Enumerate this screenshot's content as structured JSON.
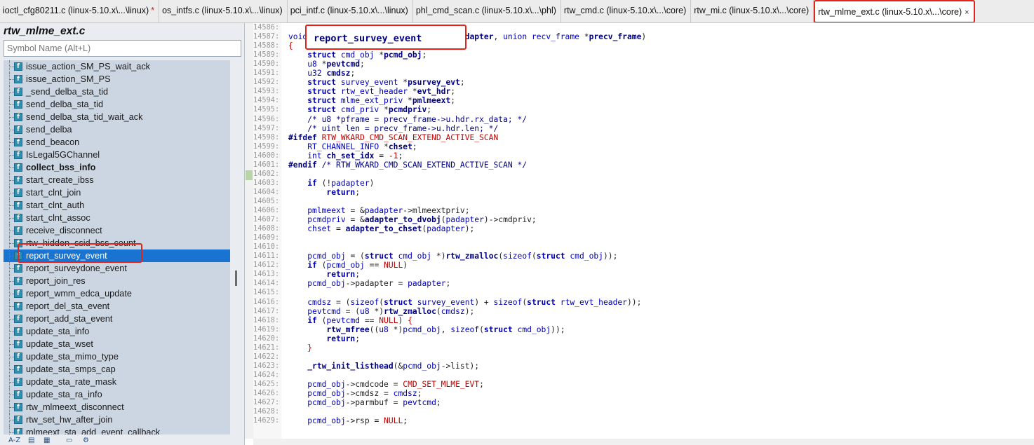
{
  "tabs": [
    {
      "label": "ioctl_cfg80211.c (linux-5.10.x\\...\\linux)",
      "dirty": "*",
      "active": false
    },
    {
      "label": "os_intfs.c (linux-5.10.x\\...\\linux)",
      "active": false
    },
    {
      "label": "pci_intf.c (linux-5.10.x\\...\\linux)",
      "active": false
    },
    {
      "label": "phl_cmd_scan.c (linux-5.10.x\\...\\phl)",
      "active": false
    },
    {
      "label": "rtw_cmd.c (linux-5.10.x\\...\\core)",
      "active": false
    },
    {
      "label": "rtw_mi.c (linux-5.10.x\\...\\core)",
      "active": false
    },
    {
      "label": "rtw_mlme_ext.c (linux-5.10.x\\...\\core)",
      "active": true,
      "close": "×"
    }
  ],
  "symbol_panel": {
    "file_title": "rtw_mlme_ext.c",
    "search_placeholder": "Symbol Name (Alt+L)",
    "items": [
      {
        "label": "issue_action_SM_PS_wait_ack"
      },
      {
        "label": "issue_action_SM_PS"
      },
      {
        "label": "_send_delba_sta_tid"
      },
      {
        "label": "send_delba_sta_tid"
      },
      {
        "label": "send_delba_sta_tid_wait_ack"
      },
      {
        "label": "send_delba"
      },
      {
        "label": "send_beacon"
      },
      {
        "label": "IsLegal5GChannel"
      },
      {
        "label": "collect_bss_info",
        "bold": true
      },
      {
        "label": "start_create_ibss"
      },
      {
        "label": "start_clnt_join"
      },
      {
        "label": "start_clnt_auth"
      },
      {
        "label": "start_clnt_assoc"
      },
      {
        "label": "receive_disconnect"
      },
      {
        "label": "rtw_hidden_ssid_bss_count"
      },
      {
        "label": "report_survey_event",
        "selected": true
      },
      {
        "label": "report_surveydone_event"
      },
      {
        "label": "report_join_res"
      },
      {
        "label": "report_wmm_edca_update"
      },
      {
        "label": "report_del_sta_event"
      },
      {
        "label": "report_add_sta_event"
      },
      {
        "label": "update_sta_info"
      },
      {
        "label": "update_sta_wset"
      },
      {
        "label": "update_sta_mimo_type"
      },
      {
        "label": "update_sta_smps_cap"
      },
      {
        "label": "update_sta_rate_mask"
      },
      {
        "label": "update_sta_ra_info"
      },
      {
        "label": "rtw_mlmeext_disconnect"
      },
      {
        "label": "rtw_set_hw_after_join"
      },
      {
        "label": "mlmeext_sta_add_event_callback"
      }
    ],
    "tool_labels": [
      "A-Z"
    ],
    "function_icon": "function-icon",
    "colors": {
      "selected": "#1874d0",
      "highlight_box": "#e3241b"
    }
  },
  "editor": {
    "function_name": "report_survey_event",
    "line_numbers": [
      "14586:",
      "14587:",
      "14588:",
      "14589:",
      "14590:",
      "14591:",
      "14592:",
      "14593:",
      "14594:",
      "14595:",
      "14596:",
      "14597:",
      "14598:",
      "14599:",
      "14600:",
      "14601:",
      "14602:",
      "14603:",
      "14604:",
      "14605:",
      "14606:",
      "14607:",
      "14608:",
      "14609:",
      "14610:",
      "14611:",
      "14612:",
      "14613:",
      "14614:",
      "14615:",
      "14616:",
      "14617:",
      "14618:",
      "14619:",
      "14620:",
      "14621:",
      "14622:",
      "14623:",
      "14624:",
      "14625:",
      "14626:",
      "14627:",
      "14628:",
      "14629:"
    ],
    "lines": [
      {
        "segs": []
      },
      {
        "segs": [
          [
            "kw",
            "void "
          ],
          [
            "fn",
            "report_survey_event"
          ],
          [
            "plain",
            "("
          ],
          [
            "kw",
            "_adapter "
          ],
          [
            "plain",
            "*"
          ],
          [
            "var",
            "padapter"
          ],
          [
            "plain",
            ", "
          ],
          [
            "kw",
            "union recv_frame "
          ],
          [
            "plain",
            "*"
          ],
          [
            "var",
            "precv_frame"
          ],
          [
            "plain",
            ")"
          ]
        ]
      },
      {
        "segs": [
          [
            "brace",
            "{"
          ]
        ]
      },
      {
        "segs": [
          [
            "plain",
            "    "
          ],
          [
            "kwb",
            "struct "
          ],
          [
            "kw",
            "cmd_obj "
          ],
          [
            "plain",
            "*"
          ],
          [
            "var",
            "pcmd_obj"
          ],
          [
            "plain",
            ";"
          ]
        ]
      },
      {
        "segs": [
          [
            "plain",
            "    "
          ],
          [
            "kw",
            "u8 "
          ],
          [
            "plain",
            "*"
          ],
          [
            "var",
            "pevtcmd"
          ],
          [
            "plain",
            ";"
          ]
        ]
      },
      {
        "segs": [
          [
            "plain",
            "    "
          ],
          [
            "kw",
            "u32 "
          ],
          [
            "var",
            "cmdsz"
          ],
          [
            "plain",
            ";"
          ]
        ]
      },
      {
        "segs": [
          [
            "plain",
            "    "
          ],
          [
            "kwb",
            "struct "
          ],
          [
            "kw",
            "survey_event "
          ],
          [
            "plain",
            "*"
          ],
          [
            "var",
            "psurvey_evt"
          ],
          [
            "plain",
            ";"
          ]
        ]
      },
      {
        "segs": [
          [
            "plain",
            "    "
          ],
          [
            "kwb",
            "struct "
          ],
          [
            "kw",
            "rtw_evt_header "
          ],
          [
            "plain",
            "*"
          ],
          [
            "var",
            "evt_hdr"
          ],
          [
            "plain",
            ";"
          ]
        ]
      },
      {
        "segs": [
          [
            "plain",
            "    "
          ],
          [
            "kwb",
            "struct "
          ],
          [
            "kw",
            "mlme_ext_priv "
          ],
          [
            "plain",
            "*"
          ],
          [
            "var",
            "pmlmeext"
          ],
          [
            "plain",
            ";"
          ]
        ]
      },
      {
        "segs": [
          [
            "plain",
            "    "
          ],
          [
            "kwb",
            "struct "
          ],
          [
            "kw",
            "cmd_priv "
          ],
          [
            "plain",
            "*"
          ],
          [
            "var",
            "pcmdpriv"
          ],
          [
            "plain",
            ";"
          ]
        ]
      },
      {
        "segs": [
          [
            "plain",
            "    "
          ],
          [
            "cm",
            "/* u8 *pframe = precv_frame->u.hdr.rx_data; */"
          ]
        ]
      },
      {
        "segs": [
          [
            "plain",
            "    "
          ],
          [
            "cm",
            "/* uint len = precv_frame->u.hdr.len; */"
          ]
        ]
      },
      {
        "segs": [
          [
            "pp",
            "#ifdef "
          ],
          [
            "mac",
            "RTW_WKARD_CMD_SCAN_EXTEND_ACTIVE_SCAN"
          ]
        ]
      },
      {
        "segs": [
          [
            "plain",
            "    "
          ],
          [
            "kw",
            "RT_CHANNEL_INFO "
          ],
          [
            "plain",
            "*"
          ],
          [
            "var",
            "chset"
          ],
          [
            "plain",
            ";"
          ]
        ]
      },
      {
        "segs": [
          [
            "plain",
            "    "
          ],
          [
            "kw",
            "int "
          ],
          [
            "var",
            "ch_set_idx"
          ],
          [
            "plain",
            " = "
          ],
          [
            "num",
            "-1"
          ],
          [
            "plain",
            ";"
          ]
        ]
      },
      {
        "segs": [
          [
            "pp",
            "#endif "
          ],
          [
            "cm",
            "/* RTW_WKARD_CMD_SCAN_EXTEND_ACTIVE_SCAN */"
          ]
        ]
      },
      {
        "segs": []
      },
      {
        "segs": [
          [
            "plain",
            "    "
          ],
          [
            "kwb",
            "if "
          ],
          [
            "plain",
            "(!"
          ],
          [
            "kw",
            "padapter"
          ],
          [
            "plain",
            ")"
          ]
        ]
      },
      {
        "segs": [
          [
            "plain",
            "        "
          ],
          [
            "kwb",
            "return"
          ],
          [
            "plain",
            ";"
          ]
        ]
      },
      {
        "segs": []
      },
      {
        "segs": [
          [
            "plain",
            "    "
          ],
          [
            "kw",
            "pmlmeext"
          ],
          [
            "plain",
            " = &"
          ],
          [
            "kw",
            "padapter"
          ],
          [
            "plain",
            "->mlmeextpriv;"
          ]
        ]
      },
      {
        "segs": [
          [
            "plain",
            "    "
          ],
          [
            "kw",
            "pcmdpriv"
          ],
          [
            "plain",
            " = &"
          ],
          [
            "fn",
            "adapter_to_dvobj"
          ],
          [
            "plain",
            "("
          ],
          [
            "kw",
            "padapter"
          ],
          [
            "plain",
            ")->cmdpriv;"
          ]
        ]
      },
      {
        "segs": [
          [
            "plain",
            "    "
          ],
          [
            "kw",
            "chset"
          ],
          [
            "plain",
            " = "
          ],
          [
            "fn",
            "adapter_to_chset"
          ],
          [
            "plain",
            "("
          ],
          [
            "kw",
            "padapter"
          ],
          [
            "plain",
            ");"
          ]
        ]
      },
      {
        "segs": []
      },
      {
        "segs": []
      },
      {
        "segs": [
          [
            "plain",
            "    "
          ],
          [
            "kw",
            "pcmd_obj"
          ],
          [
            "plain",
            " = ("
          ],
          [
            "kwb",
            "struct "
          ],
          [
            "kw",
            "cmd_obj "
          ],
          [
            "plain",
            "*)"
          ],
          [
            "fn",
            "rtw_zmalloc"
          ],
          [
            "plain",
            "("
          ],
          [
            "kw",
            "sizeof"
          ],
          [
            "plain",
            "("
          ],
          [
            "kwb",
            "struct "
          ],
          [
            "kw",
            "cmd_obj"
          ],
          [
            "plain",
            "));"
          ]
        ]
      },
      {
        "segs": [
          [
            "plain",
            "    "
          ],
          [
            "kwb",
            "if "
          ],
          [
            "plain",
            "("
          ],
          [
            "kw",
            "pcmd_obj"
          ],
          [
            "plain",
            " == "
          ],
          [
            "mac",
            "NULL"
          ],
          [
            "plain",
            ")"
          ]
        ]
      },
      {
        "segs": [
          [
            "plain",
            "        "
          ],
          [
            "kwb",
            "return"
          ],
          [
            "plain",
            ";"
          ]
        ]
      },
      {
        "segs": [
          [
            "plain",
            "    "
          ],
          [
            "kw",
            "pcmd_obj"
          ],
          [
            "plain",
            "->padapter = "
          ],
          [
            "kw",
            "padapter"
          ],
          [
            "plain",
            ";"
          ]
        ]
      },
      {
        "segs": []
      },
      {
        "segs": [
          [
            "plain",
            "    "
          ],
          [
            "kw",
            "cmdsz"
          ],
          [
            "plain",
            " = ("
          ],
          [
            "kw",
            "sizeof"
          ],
          [
            "plain",
            "("
          ],
          [
            "kwb",
            "struct "
          ],
          [
            "kw",
            "survey_event"
          ],
          [
            "plain",
            ") + "
          ],
          [
            "kw",
            "sizeof"
          ],
          [
            "plain",
            "("
          ],
          [
            "kwb",
            "struct "
          ],
          [
            "kw",
            "rtw_evt_header"
          ],
          [
            "plain",
            "));"
          ]
        ]
      },
      {
        "segs": [
          [
            "plain",
            "    "
          ],
          [
            "kw",
            "pevtcmd"
          ],
          [
            "plain",
            " = ("
          ],
          [
            "kw",
            "u8 "
          ],
          [
            "plain",
            "*)"
          ],
          [
            "fn",
            "rtw_zmalloc"
          ],
          [
            "plain",
            "("
          ],
          [
            "kw",
            "cmdsz"
          ],
          [
            "plain",
            ");"
          ]
        ]
      },
      {
        "segs": [
          [
            "plain",
            "    "
          ],
          [
            "kwb",
            "if "
          ],
          [
            "plain",
            "("
          ],
          [
            "kw",
            "pevtcmd"
          ],
          [
            "plain",
            " == "
          ],
          [
            "mac",
            "NULL"
          ],
          [
            "plain",
            ") "
          ],
          [
            "brace",
            "{"
          ]
        ]
      },
      {
        "segs": [
          [
            "plain",
            "        "
          ],
          [
            "fn",
            "rtw_mfree"
          ],
          [
            "plain",
            "(("
          ],
          [
            "kw",
            "u8 "
          ],
          [
            "plain",
            "*)"
          ],
          [
            "kw",
            "pcmd_obj"
          ],
          [
            "plain",
            ", "
          ],
          [
            "kw",
            "sizeof"
          ],
          [
            "plain",
            "("
          ],
          [
            "kwb",
            "struct "
          ],
          [
            "kw",
            "cmd_obj"
          ],
          [
            "plain",
            "));"
          ]
        ]
      },
      {
        "segs": [
          [
            "plain",
            "        "
          ],
          [
            "kwb",
            "return"
          ],
          [
            "plain",
            ";"
          ]
        ]
      },
      {
        "segs": [
          [
            "plain",
            "    "
          ],
          [
            "brace",
            "}"
          ]
        ]
      },
      {
        "segs": []
      },
      {
        "segs": [
          [
            "plain",
            "    "
          ],
          [
            "fn",
            "_rtw_init_listhead"
          ],
          [
            "plain",
            "(&"
          ],
          [
            "kw",
            "pcmd_obj"
          ],
          [
            "plain",
            "->list);"
          ]
        ]
      },
      {
        "segs": []
      },
      {
        "segs": [
          [
            "plain",
            "    "
          ],
          [
            "kw",
            "pcmd_obj"
          ],
          [
            "plain",
            "->cmdcode = "
          ],
          [
            "mac",
            "CMD_SET_MLME_EVT"
          ],
          [
            "plain",
            ";"
          ]
        ]
      },
      {
        "segs": [
          [
            "plain",
            "    "
          ],
          [
            "kw",
            "pcmd_obj"
          ],
          [
            "plain",
            "->cmdsz = "
          ],
          [
            "kw",
            "cmdsz"
          ],
          [
            "plain",
            ";"
          ]
        ]
      },
      {
        "segs": [
          [
            "plain",
            "    "
          ],
          [
            "kw",
            "pcmd_obj"
          ],
          [
            "plain",
            "->parmbuf = "
          ],
          [
            "kw",
            "pevtcmd"
          ],
          [
            "plain",
            ";"
          ]
        ]
      },
      {
        "segs": []
      },
      {
        "segs": [
          [
            "plain",
            "    "
          ],
          [
            "kw",
            "pcmd_obj"
          ],
          [
            "plain",
            "->rsp = "
          ],
          [
            "mac",
            "NULL"
          ],
          [
            "plain",
            ";"
          ]
        ]
      }
    ]
  }
}
